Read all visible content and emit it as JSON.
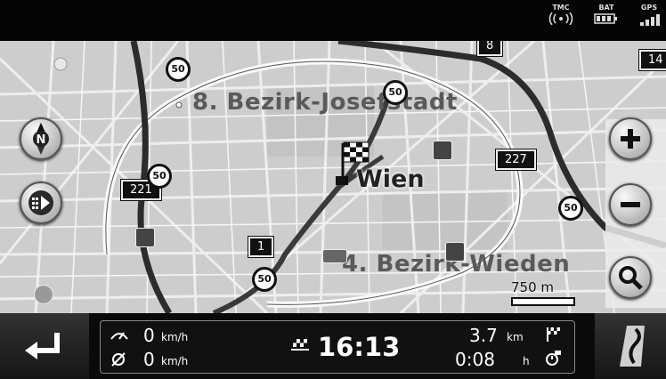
{
  "status": {
    "tmc_label": "TMC",
    "bat_label": "BAT",
    "gps_label": "GPS"
  },
  "map": {
    "districts": [
      "8. Bezirk-Josefstadt",
      "4. Bezirk-Wieden"
    ],
    "city": "Wien",
    "road_signs": [
      "221",
      "227",
      "1",
      "8",
      "14"
    ],
    "speed_limits": [
      "50",
      "50",
      "50",
      "50",
      "50"
    ],
    "scale": "750 m",
    "icons": {
      "compass": "north-compass-icon",
      "zoom_in": "plus-icon",
      "zoom_out": "minus-icon",
      "search": "magnifier-icon",
      "route": "route-play-icon",
      "destination": "checkered-flag-icon"
    }
  },
  "bottom": {
    "speed_value": "0",
    "speed_unit": "km/h",
    "avg_speed_value": "0",
    "avg_speed_unit": "km/h",
    "time": "16:13",
    "distance_value": "3.7",
    "distance_unit": "km",
    "remaining_time": "0:08",
    "remaining_unit": "h"
  },
  "colors": {
    "map_bg": "#cfcfcf",
    "road": "#f4f4f4",
    "route": "#3c3c3c",
    "bar": "#0a0a0a"
  }
}
